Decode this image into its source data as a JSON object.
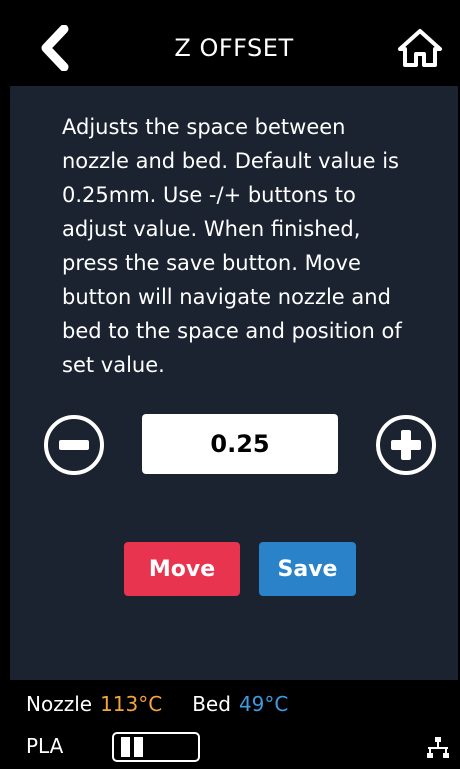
{
  "header": {
    "title": "Z OFFSET",
    "back_icon": "chevron-left-icon",
    "home_icon": "home-icon"
  },
  "main": {
    "description": "Adjusts the space between nozzle and bed. Default value is 0.25mm. Use -/+ buttons to adjust value. When finished, press the save button. Move button will navigate nozzle and bed to the space and position of set value.",
    "offset_value": "0.25",
    "move_label": "Move",
    "save_label": "Save"
  },
  "status_bar": {
    "nozzle_label": "Nozzle",
    "nozzle_temp": "113°C",
    "bed_label": "Bed",
    "bed_temp": "49°C",
    "material": "PLA",
    "network_icon": "network-icon"
  },
  "colors": {
    "background": "#1b2230",
    "move_button": "#e8344f",
    "save_button": "#2a82c9",
    "nozzle_temp": "#f4a340",
    "bed_temp": "#3d9be0"
  }
}
